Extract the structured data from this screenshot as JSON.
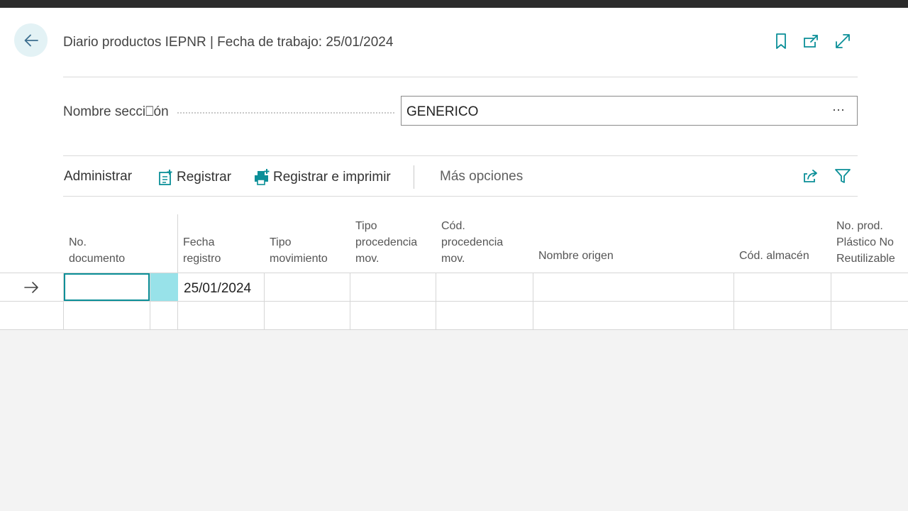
{
  "header": {
    "title": "Diario productos IEPNR | Fecha de trabajo: 25/01/2024",
    "icons": [
      "back-arrow-icon",
      "bookmark-icon",
      "open-new-window-icon",
      "expand-icon"
    ]
  },
  "section": {
    "label": "Nombre secci⎕ón",
    "value": "GENERICO",
    "more": "⋯"
  },
  "actions": {
    "administrar": "Administrar",
    "registrar": "Registrar",
    "registrar_imprimir": "Registrar e imprimir",
    "mas_opciones": "Más opciones",
    "icons": [
      "share-icon",
      "filter-icon"
    ]
  },
  "table": {
    "columns": [
      {
        "l1": "",
        "l2": "No.",
        "l3": "documento"
      },
      {
        "l1": "",
        "l2": "Fecha",
        "l3": "registro"
      },
      {
        "l1": "",
        "l2": "Tipo",
        "l3": "movimiento"
      },
      {
        "l1": "Tipo",
        "l2": "procedencia",
        "l3": "mov."
      },
      {
        "l1": "Cód.",
        "l2": "procedencia",
        "l3": "mov."
      },
      {
        "l1": "",
        "l2": "",
        "l3": "Nombre origen"
      },
      {
        "l1": "",
        "l2": "",
        "l3": "Cód. almacén"
      },
      {
        "l1": "No. prod.",
        "l2": "Plástico No",
        "l3": "Reutilizable"
      }
    ],
    "rows": [
      {
        "documento": "",
        "fecha": "25/01/2024"
      }
    ]
  },
  "colors": {
    "accent": "#0b8f98",
    "accent_light": "#98e2e9",
    "back_bg": "#e3f2f5",
    "page_bg": "#f3f3f3"
  }
}
